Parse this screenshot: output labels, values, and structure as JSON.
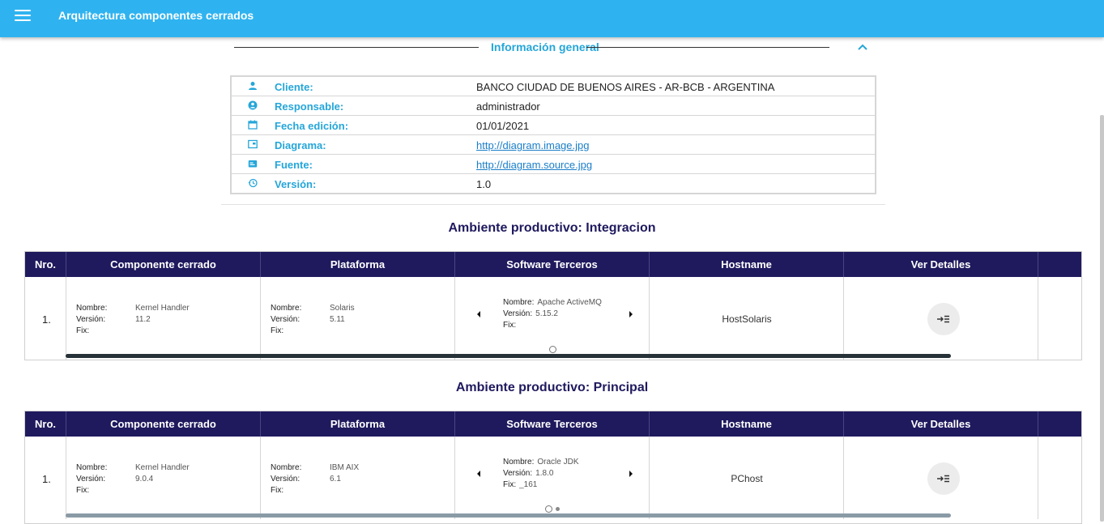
{
  "app": {
    "title": "Arquitectura componentes cerrados"
  },
  "info": {
    "section_title": "Información general",
    "rows": [
      {
        "label": "Cliente:",
        "value": "BANCO CIUDAD DE BUENOS AIRES - AR-BCB - ARGENTINA",
        "icon": "person-icon"
      },
      {
        "label": "Responsable:",
        "value": "administrador",
        "icon": "account-circle-icon"
      },
      {
        "label": "Fecha edición:",
        "value": "01/01/2021",
        "icon": "calendar-icon"
      },
      {
        "label": "Diagrama:",
        "value": "http://diagram.image.jpg",
        "icon": "diagram-icon"
      },
      {
        "label": "Fuente:",
        "value": "http://diagram.source.jpg",
        "icon": "source-icon"
      },
      {
        "label": "Versión:",
        "value": "1.0",
        "icon": "history-icon"
      }
    ]
  },
  "columns": [
    "Nro.",
    "Componente cerrado",
    "Plataforma",
    "Software Terceros",
    "Hostname",
    "Ver Detalles"
  ],
  "field_labels": {
    "name": "Nombre:",
    "version": "Versión:",
    "fix": "Fix:"
  },
  "environments": [
    {
      "title": "Ambiente productivo: Integracion",
      "rows": [
        {
          "nro": "1.",
          "component": {
            "name": "Kernel Handler",
            "version": "11.2",
            "fix": ""
          },
          "platform": {
            "name": "Solaris",
            "version": "5.11",
            "fix": ""
          },
          "software": {
            "name": "Apache ActiveMQ",
            "version": "5.15.2",
            "fix": ""
          },
          "hostname": "HostSolaris"
        }
      ]
    },
    {
      "title": "Ambiente productivo: Principal",
      "rows": [
        {
          "nro": "1.",
          "component": {
            "name": "Kernel Handler",
            "version": "9.0.4",
            "fix": ""
          },
          "platform": {
            "name": "IBM AIX",
            "version": "6.1",
            "fix": ""
          },
          "software": {
            "name": "Oracle JDK",
            "version": "1.8.0",
            "fix": "_161"
          },
          "hostname": "PChost"
        }
      ]
    }
  ],
  "colors": {
    "appbar": "#2fb3f0",
    "accent": "#25a6d9",
    "header": "#1f1a5e"
  }
}
